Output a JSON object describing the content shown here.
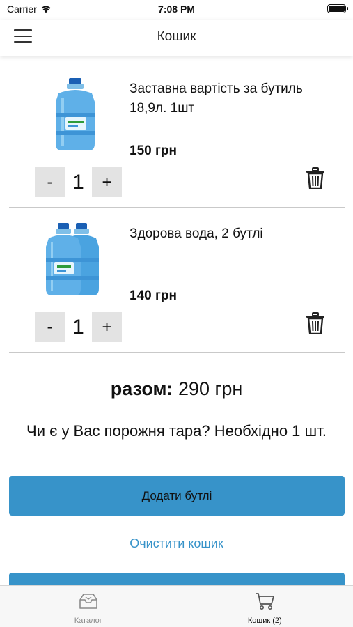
{
  "status_bar": {
    "carrier": "Carrier",
    "time": "7:08 PM"
  },
  "header": {
    "title": "Кошик",
    "menu_icon": "hamburger-menu-icon"
  },
  "cart": {
    "items": [
      {
        "name": "Заставна вартість за бутиль 18,9л. 1шт",
        "price": "150 грн",
        "quantity": "1",
        "image": "single-water-bottle",
        "minus_label": "-",
        "plus_label": "+"
      },
      {
        "name": "Здорова вода, 2 бутлі",
        "price": "140 грн",
        "quantity": "1",
        "image": "two-water-bottles",
        "minus_label": "-",
        "plus_label": "+"
      }
    ],
    "total_label": "разом:",
    "total_value": " 290 грн",
    "question": "Чи є у Вас порожня тара? Необхідно 1 шт.",
    "add_bottles_label": "Додати бутлі",
    "clear_cart_label": "Очистити кошик"
  },
  "tab_bar": {
    "tabs": [
      {
        "label": "Каталог",
        "icon": "inbox-catalog-icon",
        "active": false
      },
      {
        "label": "Кошик (2)",
        "icon": "shopping-cart-icon",
        "active": true
      }
    ]
  },
  "colors": {
    "accent": "#3793c9",
    "button_gray": "#e3e3e3",
    "divider": "#c9c9c9"
  }
}
